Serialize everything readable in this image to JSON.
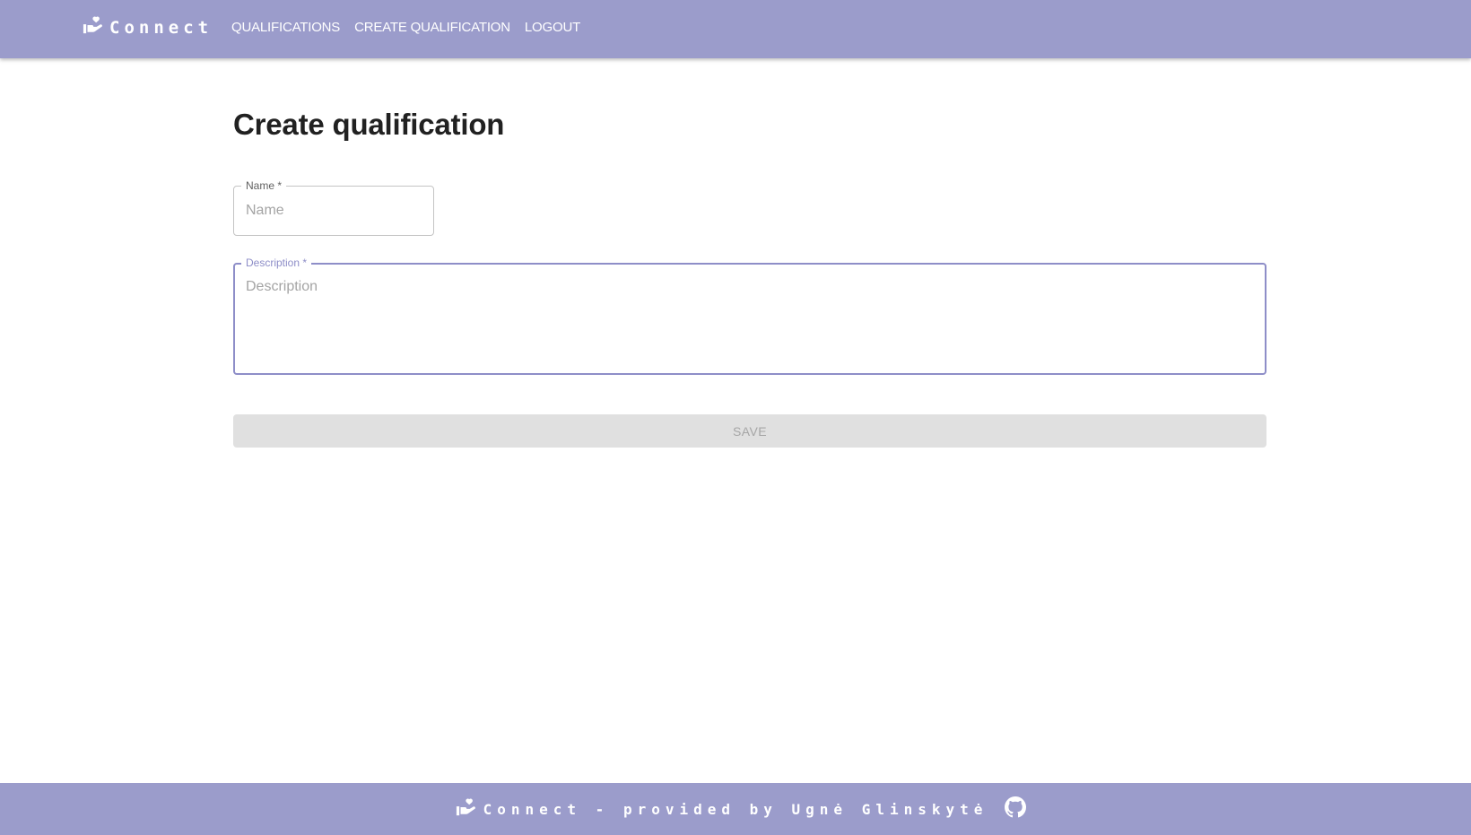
{
  "header": {
    "brand": "Connect",
    "logo_icon": "hand-heart-icon",
    "nav": [
      {
        "label": "QUALIFICATIONS"
      },
      {
        "label": "CREATE QUALIFICATION"
      },
      {
        "label": "LOGOUT"
      }
    ]
  },
  "main": {
    "title": "Create qualification",
    "name_field": {
      "label": "Name *",
      "placeholder": "Name",
      "value": ""
    },
    "description_field": {
      "label": "Description *",
      "placeholder": "Description",
      "value": ""
    },
    "save_label": "SAVE"
  },
  "footer": {
    "text": "Connect - provided by Ugnė Glinskytė",
    "logo_icon": "hand-heart-icon",
    "github_icon": "github-icon"
  },
  "colors": {
    "primary": "#9b9ccb",
    "focus": "#8e8ec8",
    "disabled_bg": "#e0e0e0",
    "disabled_text": "#a6a6a6"
  }
}
